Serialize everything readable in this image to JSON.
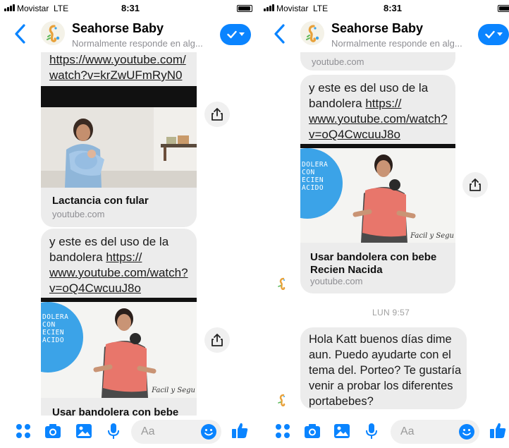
{
  "status": {
    "carrier": "Movistar",
    "network": "LTE",
    "time": "8:31"
  },
  "header": {
    "title": "Seahorse Baby",
    "subtitle": "Normalmente responde en alg...",
    "back_icon": "chevron-left-icon",
    "check_icon": "check-dropdown-icon"
  },
  "left": {
    "link_top": [
      "https://www.youtube.com/",
      "watch?v=krZwUFmRyN0"
    ],
    "preview1": {
      "title": "Lactancia con fular",
      "source": "youtube.com"
    },
    "msg2": {
      "line1": "y este es del uso de la",
      "line2_prefix": "bandolera ",
      "line2_link": "https://",
      "line3": "www.youtube.com/watch?",
      "line4": "v=oQ4CwcuuJ8o"
    },
    "preview2": {
      "title": "Usar bandolera con bebe",
      "thumb_text": [
        "DOLERA",
        "CON",
        "ECIEN",
        "ACIDO"
      ],
      "watermark": "Facil y Segu"
    }
  },
  "right": {
    "top_src": "youtube.com",
    "msg": {
      "line1": "y este es del uso de la",
      "line2_prefix": "bandolera ",
      "line2_link": "https://",
      "line3": "www.youtube.com/watch?",
      "line4": "v=oQ4CwcuuJ8o"
    },
    "preview": {
      "title_line1": "Usar bandolera con bebe",
      "title_line2": "Recien Nacida",
      "source": "youtube.com",
      "thumb_text": [
        "DOLERA",
        "CON",
        "ECIEN",
        "ACIDO"
      ],
      "watermark": "Facil y Segu"
    },
    "separator": "LUN 9:57",
    "reply": [
      "Hola Katt buenos días dime",
      "aun. Puedo ayudarte con el",
      "tema del. Porteo? Te gustaría",
      "venir a probar los diferentes",
      "portabebes?"
    ]
  },
  "composer": {
    "placeholder": "Aa",
    "icons": [
      "apps-icon",
      "camera-icon",
      "gallery-icon",
      "microphone-icon",
      "emoji-icon",
      "thumbs-up-icon"
    ]
  },
  "colors": {
    "accent": "#0a84ff",
    "bubble": "#ececec",
    "thumb_blue": "#3ba3e8",
    "wrap_coral": "#e8766b"
  }
}
